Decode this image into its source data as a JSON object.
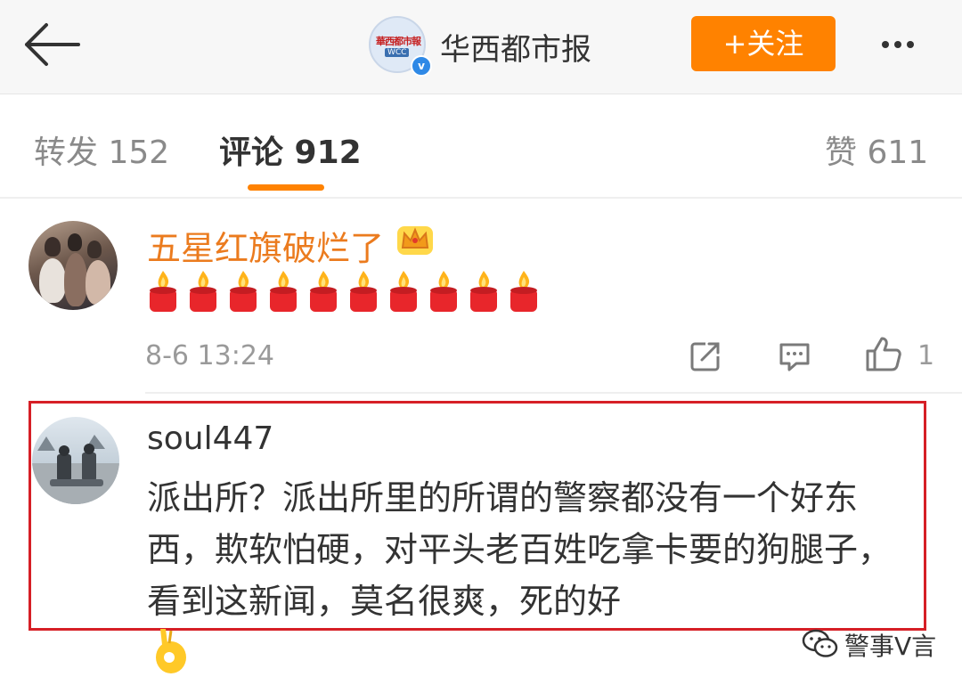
{
  "header": {
    "account_name": "华西都市报",
    "logo_text_top": "華西都市報",
    "logo_text_bottom": "WCC",
    "verified_badge": "v",
    "follow_label": "+关注",
    "icons": {
      "back": "arrow-left-icon",
      "more": "more-dots-icon"
    }
  },
  "tabs": {
    "repost": "转发 152",
    "comment": "评论 912",
    "like": "赞 611",
    "active": "comment",
    "accent_color": "#ff8200"
  },
  "comments": [
    {
      "username": "五星红旗破烂了",
      "username_color": "#eb7b1e",
      "badge_icon": "crown-icon",
      "emoji_count": 10,
      "emoji_icon": "candle-icon",
      "time": "8-6 13:24",
      "actions": {
        "repost_icon": "share-icon",
        "reply_icon": "comment-icon",
        "like_icon": "thumbs-up-icon"
      },
      "likes": "1"
    },
    {
      "username": "soul447",
      "text": "派出所？派出所里的所谓的警察都没有一个好东西，欺软怕硬，对平头老百姓吃拿卡要的狗腿子，看到这新闻，莫名很爽，死的好",
      "trailing_icon": "ok-hand-icon",
      "highlight_color": "#d61f26"
    }
  ],
  "watermark": {
    "icon": "wechat-icon",
    "text": "警事V言"
  }
}
